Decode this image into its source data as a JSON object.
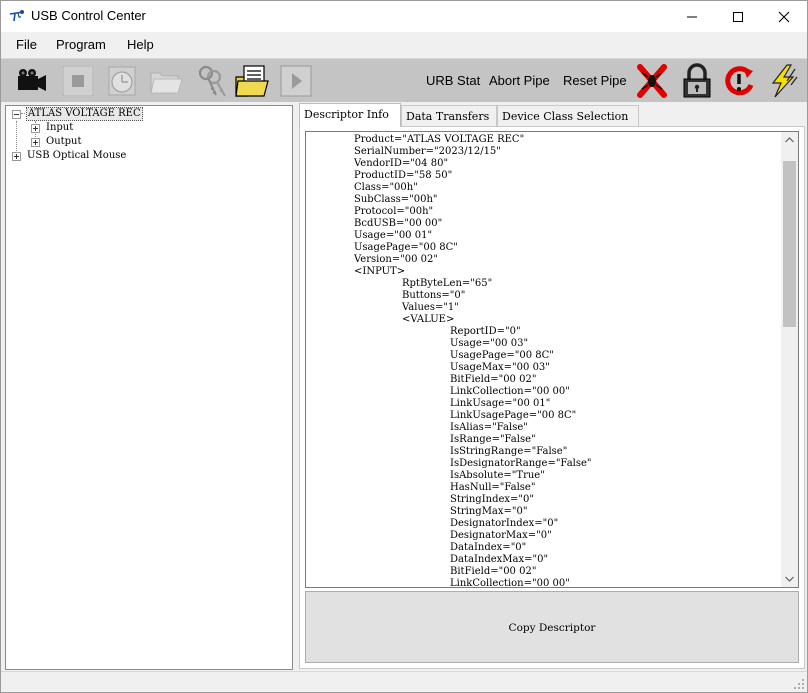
{
  "window": {
    "title": "USB Control Center"
  },
  "menu": [
    "File",
    "Program",
    "Help"
  ],
  "toolbar": {
    "icons": [
      "camera-icon",
      "stop-icon",
      "timer-icon",
      "folder-icon",
      "keys-icon",
      "document-icon",
      "play-icon",
      "abort-x-icon",
      "lock-icon",
      "reset-icon",
      "lightning-icon"
    ],
    "urb_stat_label": "URB Stat",
    "abort_pipe_label": "Abort Pipe",
    "reset_pipe_label": "Reset Pipe"
  },
  "tree": {
    "device1": "ATLAS VOLTAGE REC",
    "input": "Input",
    "output": "Output",
    "device2": "USB Optical Mouse"
  },
  "tabs": [
    "Descriptor Info",
    "Data Transfers",
    "Device Class Selection"
  ],
  "descriptor_lines": [
    {
      "indent": 0,
      "text": "Product=\"ATLAS VOLTAGE REC\""
    },
    {
      "indent": 0,
      "text": "SerialNumber=\"2023/12/15\""
    },
    {
      "indent": 0,
      "text": "VendorID=\"04 80\""
    },
    {
      "indent": 0,
      "text": "ProductID=\"58 50\""
    },
    {
      "indent": 0,
      "text": "Class=\"00h\""
    },
    {
      "indent": 0,
      "text": "SubClass=\"00h\""
    },
    {
      "indent": 0,
      "text": "Protocol=\"00h\""
    },
    {
      "indent": 0,
      "text": "BcdUSB=\"00 00\""
    },
    {
      "indent": 0,
      "text": "Usage=\"00 01\""
    },
    {
      "indent": 0,
      "text": "UsagePage=\"00 8C\""
    },
    {
      "indent": 0,
      "text": "Version=\"00 02\""
    },
    {
      "indent": 0,
      "text": "<INPUT>"
    },
    {
      "indent": 1,
      "text": "RptByteLen=\"65\""
    },
    {
      "indent": 1,
      "text": "Buttons=\"0\""
    },
    {
      "indent": 1,
      "text": "Values=\"1\""
    },
    {
      "indent": 1,
      "text": "<VALUE>"
    },
    {
      "indent": 2,
      "text": "ReportID=\"0\""
    },
    {
      "indent": 2,
      "text": "Usage=\"00 03\""
    },
    {
      "indent": 2,
      "text": "UsagePage=\"00 8C\""
    },
    {
      "indent": 2,
      "text": "UsageMax=\"00 03\""
    },
    {
      "indent": 2,
      "text": "BitField=\"00 02\""
    },
    {
      "indent": 2,
      "text": "LinkCollection=\"00 00\""
    },
    {
      "indent": 2,
      "text": "LinkUsage=\"00 01\""
    },
    {
      "indent": 2,
      "text": "LinkUsagePage=\"00 8C\""
    },
    {
      "indent": 2,
      "text": "IsAlias=\"False\""
    },
    {
      "indent": 2,
      "text": "IsRange=\"False\""
    },
    {
      "indent": 2,
      "text": "IsStringRange=\"False\""
    },
    {
      "indent": 2,
      "text": "IsDesignatorRange=\"False\""
    },
    {
      "indent": 2,
      "text": "IsAbsolute=\"True\""
    },
    {
      "indent": 2,
      "text": "HasNull=\"False\""
    },
    {
      "indent": 2,
      "text": "StringIndex=\"0\""
    },
    {
      "indent": 2,
      "text": "StringMax=\"0\""
    },
    {
      "indent": 2,
      "text": "DesignatorIndex=\"0\""
    },
    {
      "indent": 2,
      "text": "DesignatorMax=\"0\""
    },
    {
      "indent": 2,
      "text": "DataIndex=\"0\""
    },
    {
      "indent": 2,
      "text": "DataIndexMax=\"0\""
    },
    {
      "indent": 2,
      "text": "BitField=\"00 02\""
    },
    {
      "indent": 2,
      "text": "LinkCollection=\"00 00\""
    }
  ],
  "copy_button_label": "Copy Descriptor"
}
